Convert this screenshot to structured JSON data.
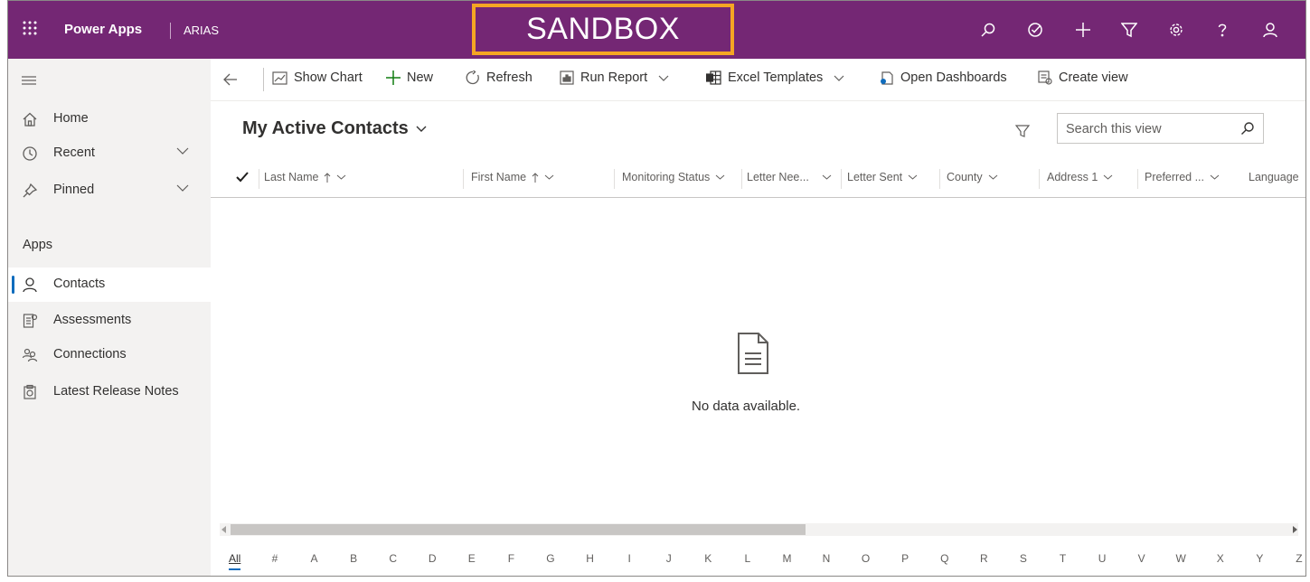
{
  "topbar": {
    "app_name": "Power Apps",
    "environment": "ARIAS",
    "sandbox_label": "SANDBOX",
    "icons": [
      "search-icon",
      "task-icon",
      "add-icon",
      "filter-icon",
      "settings-icon",
      "help-icon",
      "user-icon"
    ],
    "bg_color": "#742774",
    "sandbox_border_color": "#f5a623"
  },
  "sidebar": {
    "items": [
      {
        "label": "Home",
        "icon": "home-icon"
      },
      {
        "label": "Recent",
        "icon": "clock-icon"
      },
      {
        "label": "Pinned",
        "icon": "pin-icon"
      }
    ],
    "apps_heading": "Apps",
    "apps": [
      {
        "label": "Contacts",
        "icon": "person-icon",
        "selected": true
      },
      {
        "label": "Assessments",
        "icon": "assessment-icon"
      },
      {
        "label": "Connections",
        "icon": "connections-icon"
      },
      {
        "label": "Latest Release Notes",
        "icon": "notes-icon"
      }
    ]
  },
  "commandbar": {
    "show_chart": "Show Chart",
    "new": "New",
    "refresh": "Refresh",
    "run_report": "Run Report",
    "excel_templates": "Excel Templates",
    "open_dashboards": "Open Dashboards",
    "create_view": "Create view"
  },
  "view": {
    "title": "My Active Contacts",
    "search_placeholder": "Search this view"
  },
  "grid": {
    "columns": [
      {
        "label": "Last Name",
        "sorted": "asc"
      },
      {
        "label": "First Name",
        "sorted": "asc"
      },
      {
        "label": "Monitoring Status"
      },
      {
        "label": "Letter Nee..."
      },
      {
        "label": "Letter Sent"
      },
      {
        "label": "County"
      },
      {
        "label": "Address 1"
      },
      {
        "label": "Preferred ..."
      },
      {
        "label": "Language"
      }
    ],
    "empty_message": "No data available."
  },
  "alphabet": [
    "All",
    "#",
    "A",
    "B",
    "C",
    "D",
    "E",
    "F",
    "G",
    "H",
    "I",
    "J",
    "K",
    "L",
    "M",
    "N",
    "O",
    "P",
    "Q",
    "R",
    "S",
    "T",
    "U",
    "V",
    "W",
    "X",
    "Y",
    "Z"
  ],
  "alphabet_selected": "All"
}
